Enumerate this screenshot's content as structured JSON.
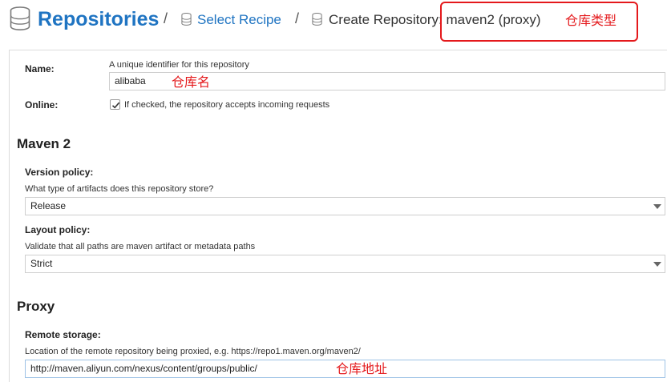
{
  "breadcrumb": {
    "root_label": "Repositories",
    "separator": "/",
    "recipe_label": "Select Recipe",
    "current_label": "Create Repository: maven2 (proxy)",
    "root_icon": "database-icon",
    "crumb_icon": "database-icon"
  },
  "annotations": {
    "repo_type": "仓库类型",
    "repo_name": "仓库名",
    "repo_url": "仓库地址",
    "color": "#e4191c"
  },
  "form": {
    "name": {
      "label": "Name:",
      "help": "A unique identifier for this repository",
      "value": "alibaba"
    },
    "online": {
      "label": "Online:",
      "checked": true,
      "help": "If checked, the repository accepts incoming requests"
    },
    "maven2": {
      "title": "Maven 2",
      "version_policy": {
        "label": "Version policy:",
        "help": "What type of artifacts does this repository store?",
        "value": "Release"
      },
      "layout_policy": {
        "label": "Layout policy:",
        "help": "Validate that all paths are maven artifact or metadata paths",
        "value": "Strict"
      }
    },
    "proxy": {
      "title": "Proxy",
      "remote_storage": {
        "label": "Remote storage:",
        "help": "Location of the remote repository being proxied, e.g. https://repo1.maven.org/maven2/",
        "value": "http://maven.aliyun.com/nexus/content/groups/public/"
      }
    }
  },
  "colors": {
    "link": "#1f74c2",
    "highlight": "#e4191c"
  }
}
